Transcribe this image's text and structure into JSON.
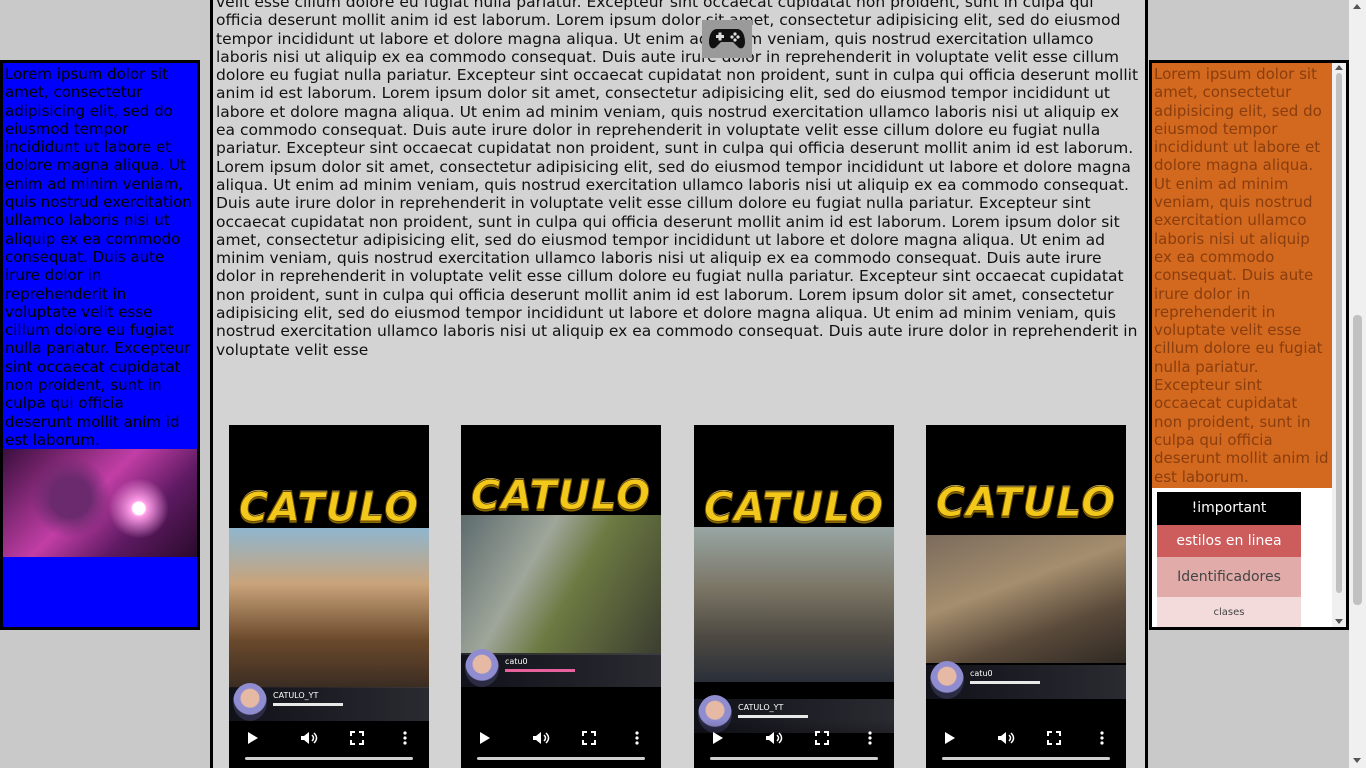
{
  "left_aside": {
    "text": "Lorem ipsum dolor sit amet, consectetur adipisicing elit, sed do eiusmod tempor incididunt ut labore et dolore magna aliqua. Ut enim ad minim veniam, quis nostrud exercitation ullamco laboris nisi ut aliquip ex ea commodo consequat. Duis aute irure dolor in reprehenderit in voluptate velit esse cillum dolore eu fugiat nulla pariatur. Excepteur sint occaecat cupidatat non proident, sunt in culpa qui officia deserunt mollit anim id est laborum.",
    "bg_color": "#0000ff"
  },
  "main": {
    "article": "velit esse cillum dolore eu fugiat nulla pariatur. Excepteur sint occaecat cupidatat non proident, sunt in culpa qui officia deserunt mollit anim id est laborum. Lorem ipsum dolor sit amet, consectetur adipisicing elit, sed do eiusmod tempor incididunt ut labore et dolore magna aliqua. Ut enim ad minim veniam, quis nostrud exercitation ullamco laboris nisi ut aliquip ex ea commodo consequat. Duis aute irure dolor in reprehenderit in voluptate velit esse cillum dolore eu fugiat nulla pariatur. Excepteur sint occaecat cupidatat non proident, sunt in culpa qui officia deserunt mollit anim id est laborum. Lorem ipsum dolor sit amet, consectetur adipisicing elit, sed do eiusmod tempor incididunt ut labore et dolore magna aliqua. Ut enim ad minim veniam, quis nostrud exercitation ullamco laboris nisi ut aliquip ex ea commodo consequat. Duis aute irure dolor in reprehenderit in voluptate velit esse cillum dolore eu fugiat nulla pariatur. Excepteur sint occaecat cupidatat non proident, sunt in culpa qui officia deserunt mollit anim id est laborum. Lorem ipsum dolor sit amet, consectetur adipisicing elit, sed do eiusmod tempor incididunt ut labore et dolore magna aliqua. Ut enim ad minim veniam, quis nostrud exercitation ullamco laboris nisi ut aliquip ex ea commodo consequat. Duis aute irure dolor in reprehenderit in voluptate velit esse cillum dolore eu fugiat nulla pariatur. Excepteur sint occaecat cupidatat non proident, sunt in culpa qui officia deserunt mollit anim id est laborum. Lorem ipsum dolor sit amet, consectetur adipisicing elit, sed do eiusmod tempor incididunt ut labore et dolore magna aliqua. Ut enim ad minim veniam, quis nostrud exercitation ullamco laboris nisi ut aliquip ex ea commodo consequat. Duis aute irure dolor in reprehenderit in voluptate velit esse cillum dolore eu fugiat nulla pariatur. Excepteur sint occaecat cupidatat non proident, sunt in culpa qui officia deserunt mollit anim id est laborum. Lorem ipsum dolor sit amet, consectetur adipisicing elit, sed do eiusmod tempor incididunt ut labore et dolore magna aliqua. Ut enim ad minim veniam, quis nostrud exercitation ullamco laboris nisi ut aliquip ex ea commodo consequat. Duis aute irure dolor in reprehenderit in voluptate velit esse",
    "videos": [
      {
        "title": "CATULO",
        "hud_name": "CATULO_YT"
      },
      {
        "title": "CATULO",
        "hud_name": "catu0"
      },
      {
        "title": "CATULO",
        "hud_name": "CATULO_YT"
      },
      {
        "title": "CATULO",
        "hud_name": "catu0"
      }
    ]
  },
  "right_aside": {
    "text": "Lorem ipsum dolor sit amet, consectetur adipisicing elit, sed do eiusmod tempor incididunt ut labore et dolore magna aliqua. Ut enim ad minim veniam, quis nostrud exercitation ullamco laboris nisi ut aliquip ex ea commodo consequat. Duis aute irure dolor in reprehenderit in voluptate velit esse cillum dolore eu fugiat nulla pariatur. Excepteur sint occaecat cupidatat non proident, sunt in culpa qui officia deserunt mollit anim id est laborum.",
    "menu": [
      "!important",
      "estilos en linea",
      "Identificadores",
      "clases"
    ],
    "bg_color": "#d2691e"
  },
  "icons": {
    "gamepad": "gamepad-icon",
    "play": "play-icon",
    "volume": "volume-icon",
    "fullscreen": "fullscreen-icon",
    "more": "more-icon"
  }
}
